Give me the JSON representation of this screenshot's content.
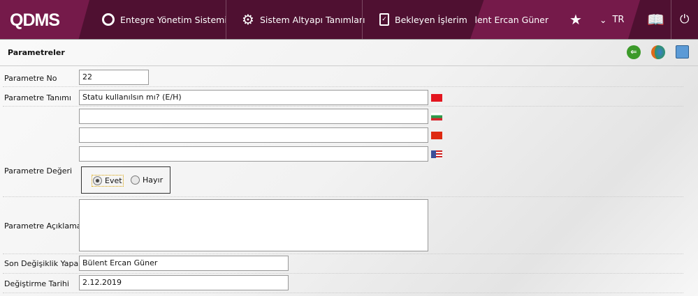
{
  "header": {
    "logo": "QDMS",
    "nav": [
      {
        "label": "Entegre Yönetim Sistemi",
        "icon": "qdms-q-icon"
      },
      {
        "label": "Sistem Altyapı Tanımları",
        "icon": "gear-icon"
      },
      {
        "label": "Bekleyen İşlerim",
        "icon": "clipboard-check-icon"
      }
    ],
    "user": "Bülent Ercan Güner",
    "language": "TR"
  },
  "toolbar": {
    "title": "Parametreler"
  },
  "form": {
    "no_label": "Parametre No",
    "no_value": "22",
    "tanim_label": "Parametre Tanımı",
    "tanim_tr": "Statu kullanılsın mı? (E/H)",
    "tanim_bg": "",
    "tanim_cn": "",
    "tanim_en": "",
    "deger_label": "Parametre Değeri",
    "radio_evet": "Evet",
    "radio_hayir": "Hayır",
    "selected": "Evet",
    "aciklama_label": "Parametre Açıklaması",
    "aciklama_value": "",
    "son_label": "Son Değişiklik Yapan",
    "son_value": "Bülent Ercan Güner",
    "tarih_label": "Değiştirme Tarihi",
    "tarih_value": "2.12.2019"
  }
}
